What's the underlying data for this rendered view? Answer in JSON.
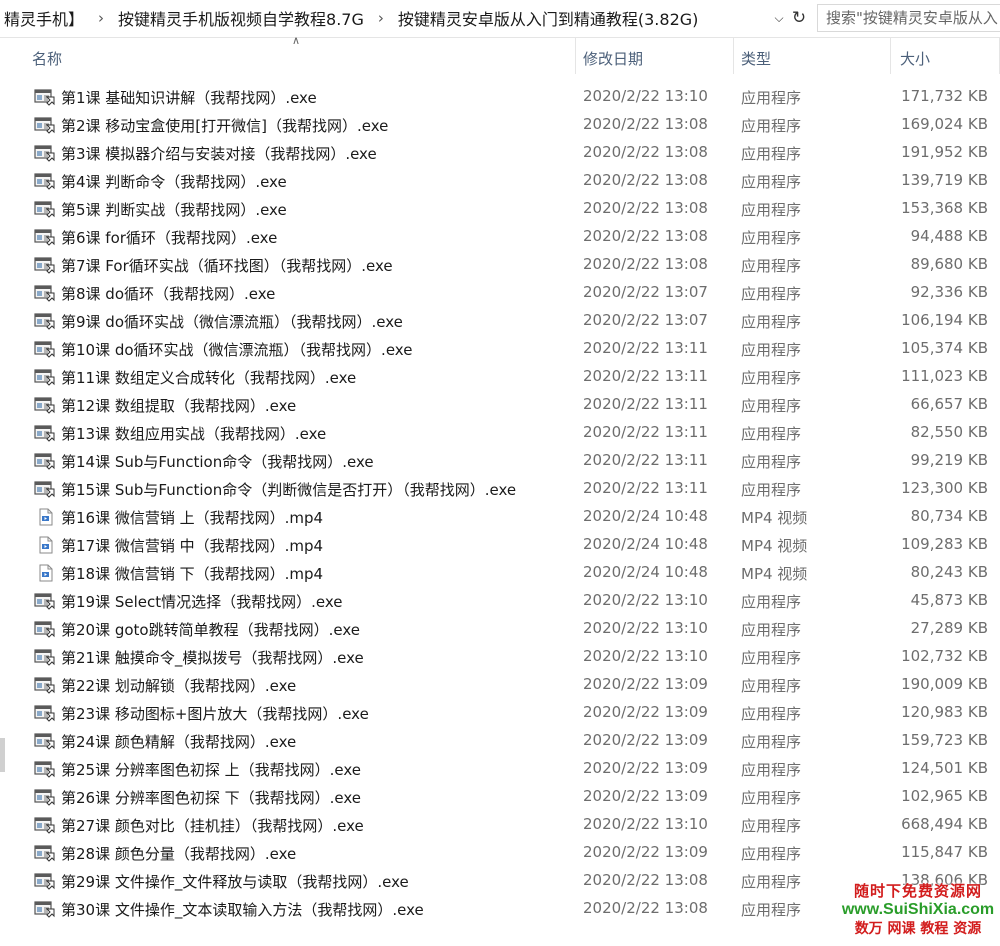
{
  "address_bar": {
    "crumbs": [
      "精灵手机】",
      "按键精灵手机版视频自学教程8.7G",
      "按键精灵安卓版从入门到精通教程(3.82G)"
    ],
    "separator": "›",
    "dropdown_icon": "chevron-down-icon",
    "refresh_icon": "refresh-icon",
    "search_placeholder": "搜索\"按键精灵安卓版从入"
  },
  "columns": {
    "name": "名称",
    "date": "修改日期",
    "type": "类型",
    "size": "大小"
  },
  "files": [
    {
      "name": "第1课 基础知识讲解（我帮找网）.exe",
      "date": "2020/2/22 13:10",
      "type": "应用程序",
      "size": "171,732 KB",
      "icon": "exe"
    },
    {
      "name": "第2课 移动宝盒使用[打开微信]（我帮找网）.exe",
      "date": "2020/2/22 13:08",
      "type": "应用程序",
      "size": "169,024 KB",
      "icon": "exe"
    },
    {
      "name": "第3课 模拟器介绍与安装对接（我帮找网）.exe",
      "date": "2020/2/22 13:08",
      "type": "应用程序",
      "size": "191,952 KB",
      "icon": "exe"
    },
    {
      "name": "第4课 判断命令（我帮找网）.exe",
      "date": "2020/2/22 13:08",
      "type": "应用程序",
      "size": "139,719 KB",
      "icon": "exe"
    },
    {
      "name": "第5课 判断实战（我帮找网）.exe",
      "date": "2020/2/22 13:08",
      "type": "应用程序",
      "size": "153,368 KB",
      "icon": "exe"
    },
    {
      "name": "第6课 for循环（我帮找网）.exe",
      "date": "2020/2/22 13:08",
      "type": "应用程序",
      "size": "94,488 KB",
      "icon": "exe"
    },
    {
      "name": "第7课 For循环实战（循环找图）（我帮找网）.exe",
      "date": "2020/2/22 13:08",
      "type": "应用程序",
      "size": "89,680 KB",
      "icon": "exe"
    },
    {
      "name": "第8课 do循环（我帮找网）.exe",
      "date": "2020/2/22 13:07",
      "type": "应用程序",
      "size": "92,336 KB",
      "icon": "exe"
    },
    {
      "name": "第9课 do循环实战（微信漂流瓶）（我帮找网）.exe",
      "date": "2020/2/22 13:07",
      "type": "应用程序",
      "size": "106,194 KB",
      "icon": "exe"
    },
    {
      "name": "第10课 do循环实战（微信漂流瓶）（我帮找网）.exe",
      "date": "2020/2/22 13:11",
      "type": "应用程序",
      "size": "105,374 KB",
      "icon": "exe"
    },
    {
      "name": "第11课 数组定义合成转化（我帮找网）.exe",
      "date": "2020/2/22 13:11",
      "type": "应用程序",
      "size": "111,023 KB",
      "icon": "exe"
    },
    {
      "name": "第12课 数组提取（我帮找网）.exe",
      "date": "2020/2/22 13:11",
      "type": "应用程序",
      "size": "66,657 KB",
      "icon": "exe"
    },
    {
      "name": "第13课 数组应用实战（我帮找网）.exe",
      "date": "2020/2/22 13:11",
      "type": "应用程序",
      "size": "82,550 KB",
      "icon": "exe"
    },
    {
      "name": "第14课 Sub与Function命令（我帮找网）.exe",
      "date": "2020/2/22 13:11",
      "type": "应用程序",
      "size": "99,219 KB",
      "icon": "exe"
    },
    {
      "name": "第15课 Sub与Function命令（判断微信是否打开）（我帮找网）.exe",
      "date": "2020/2/22 13:11",
      "type": "应用程序",
      "size": "123,300 KB",
      "icon": "exe"
    },
    {
      "name": "第16课 微信营销 上（我帮找网）.mp4",
      "date": "2020/2/24 10:48",
      "type": "MP4 视频",
      "size": "80,734 KB",
      "icon": "mp4"
    },
    {
      "name": "第17课  微信营销 中（我帮找网）.mp4",
      "date": "2020/2/24 10:48",
      "type": "MP4 视频",
      "size": "109,283 KB",
      "icon": "mp4"
    },
    {
      "name": "第18课  微信营销 下（我帮找网）.mp4",
      "date": "2020/2/24 10:48",
      "type": "MP4 视频",
      "size": "80,243 KB",
      "icon": "mp4"
    },
    {
      "name": "第19课 Select情况选择（我帮找网）.exe",
      "date": "2020/2/22 13:10",
      "type": "应用程序",
      "size": "45,873 KB",
      "icon": "exe"
    },
    {
      "name": "第20课 goto跳转简单教程（我帮找网）.exe",
      "date": "2020/2/22 13:10",
      "type": "应用程序",
      "size": "27,289 KB",
      "icon": "exe"
    },
    {
      "name": "第21课 触摸命令_模拟拨号（我帮找网）.exe",
      "date": "2020/2/22 13:10",
      "type": "应用程序",
      "size": "102,732 KB",
      "icon": "exe"
    },
    {
      "name": "第22课 划动解锁（我帮找网）.exe",
      "date": "2020/2/22 13:09",
      "type": "应用程序",
      "size": "190,009 KB",
      "icon": "exe"
    },
    {
      "name": "第23课 移动图标+图片放大（我帮找网）.exe",
      "date": "2020/2/22 13:09",
      "type": "应用程序",
      "size": "120,983 KB",
      "icon": "exe"
    },
    {
      "name": "第24课 颜色精解（我帮找网）.exe",
      "date": "2020/2/22 13:09",
      "type": "应用程序",
      "size": "159,723 KB",
      "icon": "exe"
    },
    {
      "name": "第25课 分辨率图色初探 上（我帮找网）.exe",
      "date": "2020/2/22 13:09",
      "type": "应用程序",
      "size": "124,501 KB",
      "icon": "exe"
    },
    {
      "name": "第26课 分辨率图色初探 下（我帮找网）.exe",
      "date": "2020/2/22 13:09",
      "type": "应用程序",
      "size": "102,965 KB",
      "icon": "exe"
    },
    {
      "name": "第27课 颜色对比（挂机挂）（我帮找网）.exe",
      "date": "2020/2/22 13:10",
      "type": "应用程序",
      "size": "668,494 KB",
      "icon": "exe"
    },
    {
      "name": "第28课 颜色分量（我帮找网）.exe",
      "date": "2020/2/22 13:09",
      "type": "应用程序",
      "size": "115,847 KB",
      "icon": "exe"
    },
    {
      "name": "第29课 文件操作_文件释放与读取（我帮找网）.exe",
      "date": "2020/2/22 13:08",
      "type": "应用程序",
      "size": "138,606 KB",
      "icon": "exe"
    },
    {
      "name": "第30课 文件操作_文本读取输入方法（我帮找网）.exe",
      "date": "2020/2/22 13:08",
      "type": "应用程序",
      "size": "",
      "icon": "exe"
    }
  ],
  "watermark": {
    "line1": "随时下免费资源网",
    "line2": "www.SuiShiXia.com",
    "line3": "数万 网课 教程 资源"
  },
  "colors": {
    "header_text": "#4c607a",
    "detail_text": "#6d6d6d",
    "watermark_red": "#d21d1d",
    "watermark_green": "#2a9d2a"
  }
}
